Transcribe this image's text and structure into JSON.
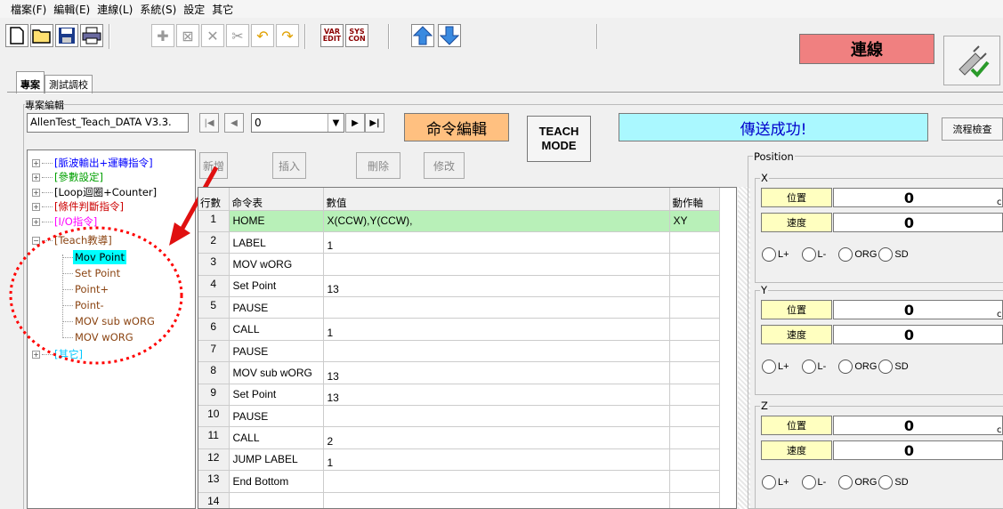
{
  "menu": [
    "檔案(F)",
    "編輯(E)",
    "連線(L)",
    "系統(S)",
    "設定",
    "其它"
  ],
  "toolbar": {
    "var_edit": [
      "VAR",
      "EDIT"
    ],
    "sys_con": [
      "SYS",
      "CON"
    ]
  },
  "connection_status": "連線",
  "tabs": [
    "專案",
    "測試調校"
  ],
  "project_group_label": "專案編輯",
  "project_name": "AllenTest_Teach_DATA V3.3.",
  "nav": {
    "combo_value": "0"
  },
  "command_edit_label": "命令編輯",
  "teach_mode": [
    "TEACH",
    "MODE"
  ],
  "transfer_status": "傳送成功!",
  "flow_check_label": "流程檢查",
  "edit_buttons": {
    "add": "新增",
    "insert": "插入",
    "delete": "刪除",
    "modify": "修改"
  },
  "tree": {
    "items": [
      {
        "label": "[脈波輸出+運轉指令]",
        "color": "#0000ff"
      },
      {
        "label": "[參數設定]",
        "color": "#00a000"
      },
      {
        "label": "[Loop迴圈+Counter]",
        "color": "#000000"
      },
      {
        "label": "[條件判斷指令]",
        "color": "#cc0000"
      },
      {
        "label": "[I/O指令]",
        "color": "#ff00ff"
      },
      {
        "label": "[Teach教導]",
        "color": "#8b4513"
      },
      {
        "label": "[其它]",
        "color": "#00c8ff"
      }
    ],
    "teach_children": [
      "Mov Point",
      "Set Point",
      "Point+",
      "Point-",
      "MOV sub wORG",
      "MOV wORG"
    ]
  },
  "table": {
    "headers": [
      "行數",
      "命令表",
      "數值",
      "動作軸"
    ],
    "rows": [
      {
        "n": "1",
        "cmd": "HOME",
        "val": "X(CCW),Y(CCW),",
        "axis": "XY"
      },
      {
        "n": "2",
        "cmd": "LABEL",
        "val": "1",
        "axis": ""
      },
      {
        "n": "3",
        "cmd": "MOV wORG",
        "val": "",
        "axis": ""
      },
      {
        "n": "4",
        "cmd": "Set Point",
        "val": "13",
        "axis": ""
      },
      {
        "n": "5",
        "cmd": "PAUSE",
        "val": "",
        "axis": ""
      },
      {
        "n": "6",
        "cmd": "CALL",
        "val": "1",
        "axis": ""
      },
      {
        "n": "7",
        "cmd": "PAUSE",
        "val": "",
        "axis": ""
      },
      {
        "n": "8",
        "cmd": "MOV sub wORG",
        "val": "13",
        "axis": ""
      },
      {
        "n": "9",
        "cmd": "Set Point",
        "val": "13",
        "axis": ""
      },
      {
        "n": "10",
        "cmd": "PAUSE",
        "val": "",
        "axis": ""
      },
      {
        "n": "11",
        "cmd": "CALL",
        "val": "2",
        "axis": ""
      },
      {
        "n": "12",
        "cmd": "JUMP LABEL",
        "val": "1",
        "axis": ""
      },
      {
        "n": "13",
        "cmd": "End Bottom",
        "val": "",
        "axis": ""
      },
      {
        "n": "14",
        "cmd": "",
        "val": "",
        "axis": ""
      }
    ]
  },
  "position": {
    "legend": "Position",
    "axes": [
      {
        "name": "X",
        "pos_label": "位置",
        "pos_value": "0",
        "speed_label": "速度",
        "speed_value": "0"
      },
      {
        "name": "Y",
        "pos_label": "位置",
        "pos_value": "0",
        "speed_label": "速度",
        "speed_value": "0"
      },
      {
        "name": "Z",
        "pos_label": "位置",
        "pos_value": "0",
        "speed_label": "速度",
        "speed_value": "0"
      }
    ],
    "radios": [
      "L+",
      "L-",
      "ORG",
      "SD"
    ]
  },
  "colors": {
    "connect_bg": "#f08080",
    "command_edit_bg": "#ffc080",
    "status_bg": "#aaf8ff",
    "selected_row_bg": "#b8f0b8",
    "annotation_red": "#ff0000"
  }
}
